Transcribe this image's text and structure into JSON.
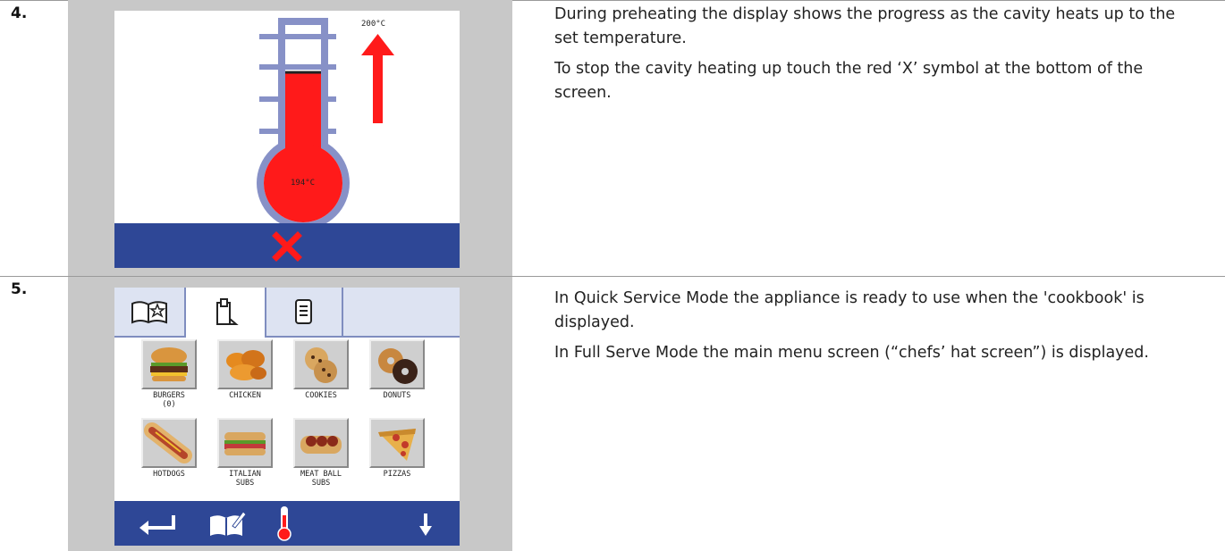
{
  "steps": [
    {
      "number": "4.",
      "screen": {
        "target_temp": "200°C",
        "current_temp": "194°C",
        "heat_progress": 0.97
      },
      "paragraphs": [
        "During preheating the display shows the progress as the cavity heats up to the set temperature.",
        "To stop the cavity heating up touch the red ‘X’ symbol at the bottom of the screen."
      ]
    },
    {
      "number": "5.",
      "screen": {
        "tabs": [
          "book-star-icon",
          "clipboard-icon",
          "document-icon"
        ],
        "categories": [
          {
            "label": "BURGERS\n(0)",
            "icon": "burger-icon"
          },
          {
            "label": "CHICKEN",
            "icon": "chicken-icon"
          },
          {
            "label": "COOKIES",
            "icon": "cookies-icon"
          },
          {
            "label": "DONUTS",
            "icon": "donuts-icon"
          },
          {
            "label": "HOTDOGS",
            "icon": "hotdog-icon"
          },
          {
            "label": "ITALIAN\nSUBS",
            "icon": "italian-sub-icon"
          },
          {
            "label": "MEAT BALL\nSUBS",
            "icon": "meatball-sub-icon"
          },
          {
            "label": "PIZZAS",
            "icon": "pizza-icon"
          }
        ],
        "bottom_icons": [
          "back-arrow-icon",
          "edit-book-icon",
          "thermometer-icon",
          "down-arrow-icon"
        ]
      },
      "paragraphs": [
        "In Quick Service Mode the appliance is ready to use when the 'cookbook' is displayed.",
        "In Full Serve Mode the main menu screen (“chefs’ hat screen”) is displayed."
      ]
    }
  ],
  "colors": {
    "panel_bar": "#2e4796",
    "mercury": "#ff1a1a",
    "tube": "#8791c7"
  }
}
